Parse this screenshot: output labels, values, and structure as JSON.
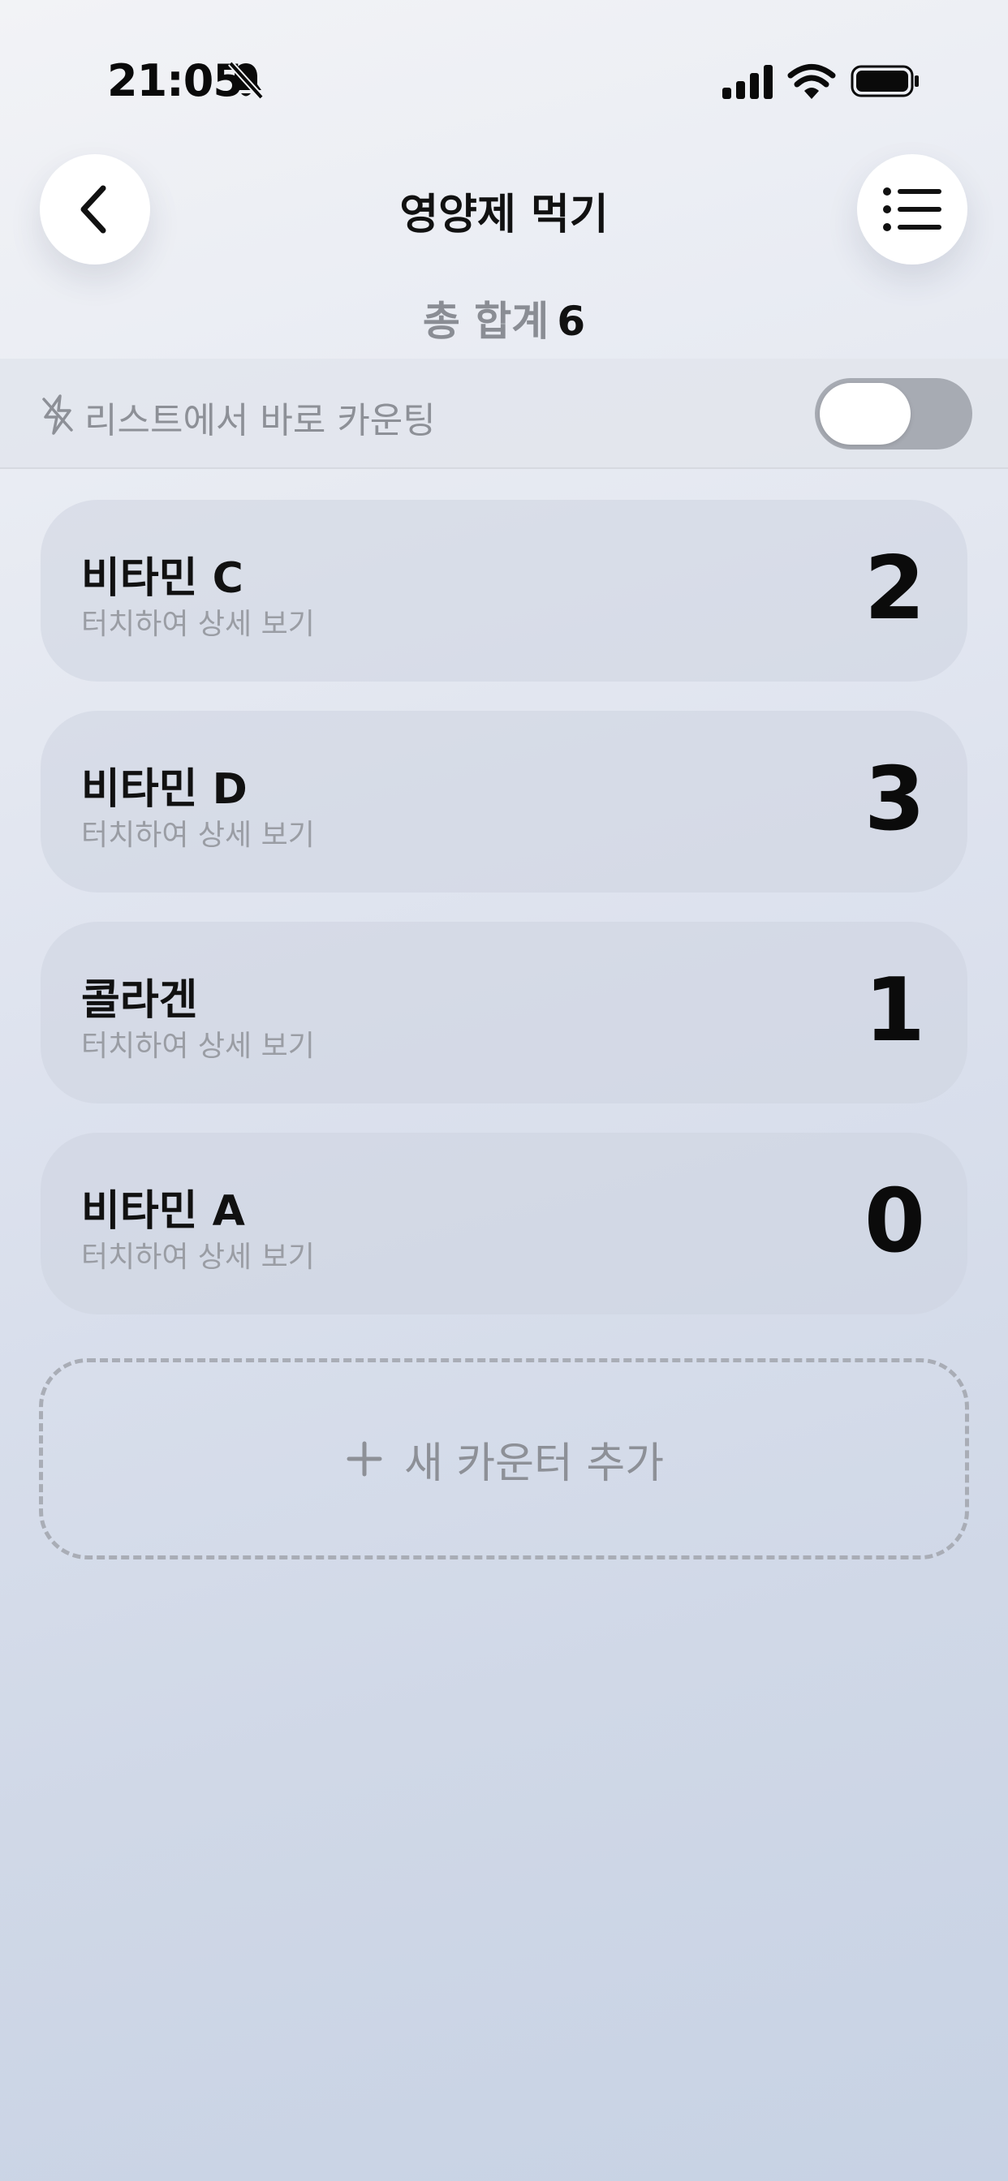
{
  "status_bar": {
    "time": "21:05",
    "icons": [
      "bell-slash-icon",
      "cellular-signal-icon",
      "wifi-icon",
      "battery-icon"
    ]
  },
  "header": {
    "back_icon": "chevron-left-icon",
    "title": "영양제 먹기",
    "menu_icon": "list-icon"
  },
  "total": {
    "label": "총 합계",
    "value": "6"
  },
  "quick_count": {
    "icon": "flash-off-icon",
    "label": "리스트에서 바로 카운팅",
    "enabled": false
  },
  "counters": [
    {
      "name": "비타민 C",
      "subtitle": "터치하여 상세 보기",
      "value": "2"
    },
    {
      "name": "비타민 D",
      "subtitle": "터치하여 상세 보기",
      "value": "3"
    },
    {
      "name": "콜라겐",
      "subtitle": "터치하여 상세 보기",
      "value": "1"
    },
    {
      "name": "비타민 A",
      "subtitle": "터치하여 상세 보기",
      "value": "0"
    }
  ],
  "add_counter": {
    "icon": "plus-icon",
    "label": "새 카운터 추가"
  },
  "colors": {
    "toggle_off_track": "#a7abb3",
    "muted_text": "#8d9097",
    "primary_text": "#111111"
  }
}
